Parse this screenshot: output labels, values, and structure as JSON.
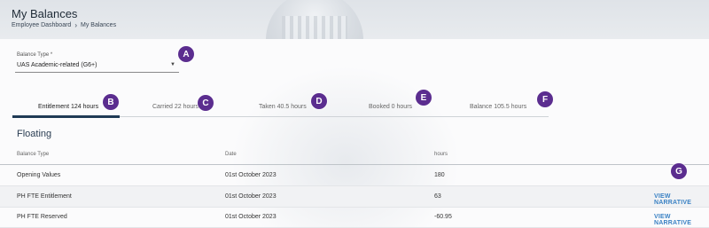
{
  "header": {
    "title": "My Balances",
    "breadcrumb": [
      "Employee Dashboard",
      "My Balances"
    ]
  },
  "balance_type": {
    "label": "Balance Type *",
    "value": "UAS Academic-related (G6+)"
  },
  "tabs": [
    {
      "label": "Entitlement 124 hours",
      "active": true
    },
    {
      "label": "Carried 22 hours"
    },
    {
      "label": "Taken 40.5 hours"
    },
    {
      "label": "Booked 0 hours"
    },
    {
      "label": "Balance 105.5 hours"
    }
  ],
  "section": {
    "title": "Floating",
    "columns": [
      "Balance Type",
      "Date",
      "hours"
    ],
    "rows": [
      {
        "type": "Opening Values",
        "date": "01st October 2023",
        "hours": "180",
        "action": ""
      },
      {
        "type": "PH FTE Entitlement",
        "date": "01st October 2023",
        "hours": "63",
        "action": "VIEW NARRATIVE"
      },
      {
        "type": "PH FTE Reserved",
        "date": "01st October 2023",
        "hours": "-60.95",
        "action": "VIEW NARRATIVE"
      }
    ]
  },
  "markers": [
    "A",
    "B",
    "C",
    "D",
    "E",
    "F",
    "G"
  ],
  "colors": {
    "marker": "#5b2d8f",
    "link": "#3b82c4",
    "active_tab": "#1f3a55"
  }
}
